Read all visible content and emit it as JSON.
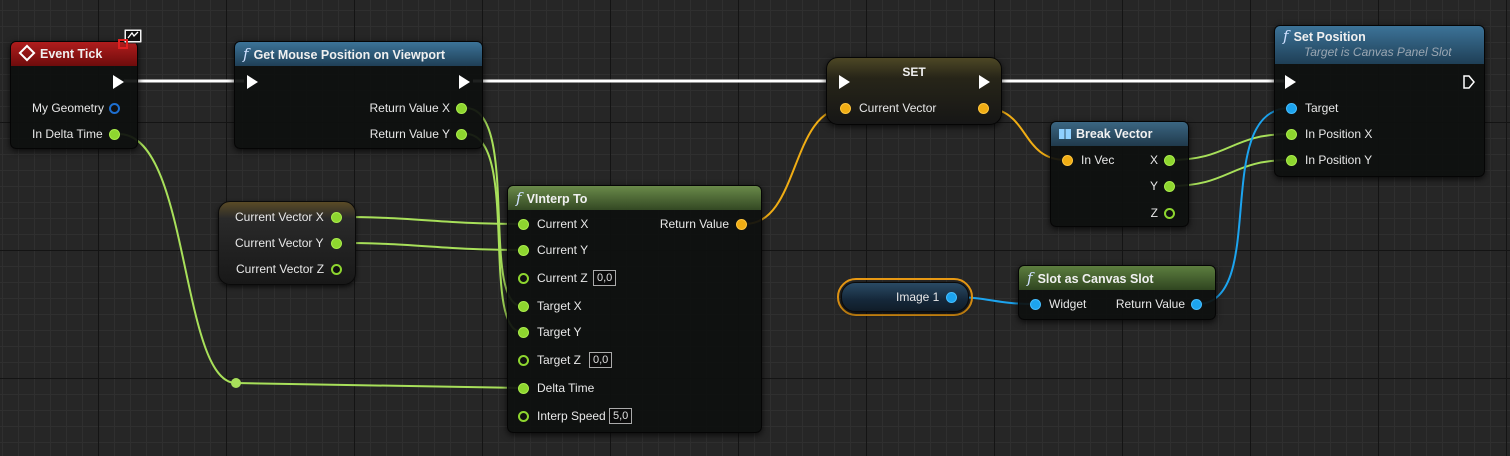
{
  "nodes": {
    "event_tick": {
      "title": "Event Tick",
      "pins": {
        "my_geometry": "My Geometry",
        "in_delta_time": "In Delta Time"
      }
    },
    "get_mouse_position": {
      "title": "Get Mouse Position on Viewport",
      "pins": {
        "return_x": "Return Value X",
        "return_y": "Return Value Y"
      }
    },
    "current_vector_getter": {
      "pins": {
        "x": "Current Vector X",
        "y": "Current Vector Y",
        "z": "Current Vector Z"
      }
    },
    "vinterp_to": {
      "title": "VInterp To",
      "pins": {
        "current_x": "Current X",
        "current_y": "Current Y",
        "current_z": "Current Z",
        "target_x": "Target X",
        "target_y": "Target Y",
        "target_z": "Target Z",
        "delta_time": "Delta Time",
        "interp_speed": "Interp Speed",
        "return_value": "Return Value"
      },
      "values": {
        "current_z": "0,0",
        "target_z": "0,0",
        "interp_speed": "5,0"
      }
    },
    "set": {
      "title": "SET",
      "pins": {
        "current_vector_in": "Current Vector"
      }
    },
    "break_vector": {
      "title": "Break Vector",
      "pins": {
        "in_vec": "In Vec",
        "x": "X",
        "y": "Y",
        "z": "Z"
      }
    },
    "set_position": {
      "title": "Set Position",
      "subtitle": "Target is Canvas Panel Slot",
      "pins": {
        "target": "Target",
        "in_position_x": "In Position X",
        "in_position_y": "In Position Y"
      }
    },
    "image_1": {
      "label": "Image 1"
    },
    "slot_as_canvas_slot": {
      "title": "Slot as Canvas Slot",
      "pins": {
        "widget": "Widget",
        "return_value": "Return Value"
      }
    }
  },
  "colors": {
    "exec": "#ffffff",
    "float": "#8ed62f",
    "vector": "#f0ad14",
    "object": "#1ca4ef",
    "event_header": "#8a1212",
    "function_header": "#2d5a78",
    "pure_header": "#5c7a3e",
    "set_header": "#6b6432",
    "selection": "#f0a020"
  },
  "icons": {
    "event": "diamond-event-icon",
    "function": "function-f-icon",
    "break": "break-struct-icon",
    "debug": "monitor-icon"
  }
}
